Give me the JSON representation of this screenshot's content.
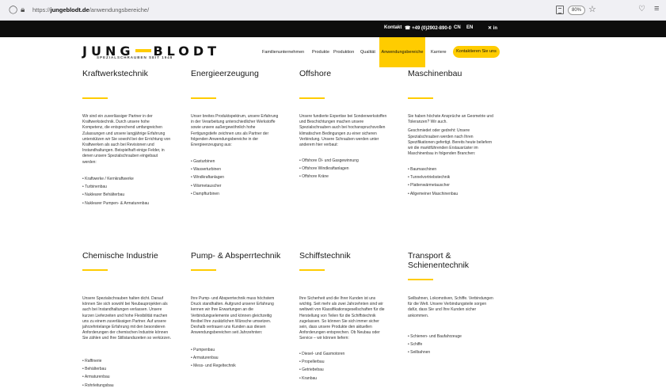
{
  "browser": {
    "url_prefix": "https://",
    "url_domain": "jungeblodt.de",
    "url_path": "/anwendungsbereiche/",
    "zoom": "80%"
  },
  "topbar": {
    "kontakt": "Kontakt",
    "phone": "☎ +49 (0)2902-890-0",
    "lang_cn": "CN",
    "lang_en": "EN",
    "social": "✕ in"
  },
  "header": {
    "logo_left": "JUNG",
    "logo_right": "BLODT",
    "logo_sub": "SPEZIALSCHRAUBEN SEIT 1948",
    "nav": [
      "Familienunternehmen",
      "Produkte",
      "Produktion",
      "Qualität",
      "Anwendungsbereiche",
      "Karriere"
    ],
    "cta": "Kontaktieren Sie uns"
  },
  "cards": [
    {
      "title": "Kraftwerkstechnik",
      "paragraphs": [
        "Wir sind ein zuverlässiger Partner in der Kraftwerkstechnik. Durch unsere hohe Kompetenz, die entsprechend umfangreichen Zulassungen und unsere langjährige Erfahrung unterstützen wir Sie sowohl bei der Errichtung von Kraftwerken als auch bei Revisionen und Instandhaltungen. Beispielhaft einige Felder, in denen unsere Spezialschrauben eingebaut werden:"
      ],
      "items": [
        "Kraftwerke / Kernkraftwerke",
        "Turbinenbau",
        "Nuklearer Behälterbau",
        "Nuklearer Pumpen- & Armaturenbau"
      ]
    },
    {
      "title": "Energieerzeugung",
      "paragraphs": [
        "Unser breites Produktspektrum, unsere Erfahrung in der Verarbeitung unterschiedlicher Werkstoffe sowie unsere außergewöhnlich hohe Fertigungstiefe zeichnen uns als Partner der folgenden Anwendungsbereiche in der Energieerzeugung aus:"
      ],
      "items": [
        "Gasturbinen",
        "Wasserturbinen",
        "Windkraftanlagen",
        "Wärmetauscher",
        "Dampfturbinen"
      ]
    },
    {
      "title": "Offshore",
      "paragraphs": [
        "Unsere fundierte Expertise bei Sonderwerkstoffen und Beschichtungen machen unsere Spezialschrauben auch bei hochanspruchsvollen klimatischen Bedingungen zu einer sicheren Verbindung. Unsere Schrauben werden unter anderem hier verbaut:"
      ],
      "items": [
        "Offshore Öl- und Gasgewinnung",
        "Offshore Windkraftanlagen",
        "Offshore Kräne"
      ]
    },
    {
      "title": "Maschinenbau",
      "paragraphs": [
        "Sie haben höchste Ansprüche an Geometrie und Toleranzen? Wir auch.",
        "Geschmiedet oder gedreht: Unsere Spezialschrauben werden nach Ihren Spezifikationen gefertigt. Bereits heute beliefern wir die marktführenden Erstausrüster im Maschinenbau in folgenden Branchen:"
      ],
      "items": [
        "Baumaschinen",
        "Tunnelvortriebstechnik",
        "Plattenwärmetauscher",
        "Allgemeiner Maschinenbau"
      ]
    },
    {
      "title": "Chemische Industrie",
      "paragraphs": [
        "Unsere Spezialschrauben halten dicht. Darauf können Sie sich sowohl bei Neubauprojekten als auch bei Instandhaltungen verlassen. Unsere kurzen Lieferzeiten und hohe Flexibilität machen uns zu einem zuverlässigen Partner. Auf unsere jahrzehntelange Erfahrung mit den besonderen Anforderungen der chemischen Industrie können Sie zählen und Ihre Stillstandszeiten so verkürzen."
      ],
      "items": [
        "Raffinerie",
        "Behälterbau",
        "Armaturenbau",
        "Rohrleitungsbau"
      ]
    },
    {
      "title": "Pump- & Absperrtechnik",
      "paragraphs": [
        "Ihre Pump- und Absperrtechnik muss höchstem Druck standhalten. Aufgrund unserer Erfahrung kennen wir Ihre Erwartungen an die Verbindungselemente und können gleichzeitig flexibel Ihre zusätzlichen Wünsche umsetzen. Deshalb vertrauen uns Kunden aus diesen Anwendungsbereichen seit Jahrzehnten:"
      ],
      "items": [
        "Pumpenbau",
        "Armaturenbau",
        "Mess- und Regeltechnik"
      ]
    },
    {
      "title": "Schiffstechnik",
      "paragraphs": [
        "Ihre Sicherheit und die Ihrer Kunden ist uns wichtig. Seit mehr als zwei Jahrzehnten sind wir weltweit von Klassifikationsgesellschaften für die Herstellung von Teilen für die Schiffstechnik zugelassen. So können Sie sich immer sicher sein, dass unsere Produkte den aktuellen Anforderungen entsprechen. Ob Neubau oder Service – wir können liefern:"
      ],
      "items": [
        "Diesel- und Gasmotoren",
        "Propellerbau",
        "Getriebebau",
        "Kranbau"
      ]
    },
    {
      "title": "Transport & Schienentechnik",
      "paragraphs": [
        "Seilbahnen, Lokomotiven, Schiffe. Verbindungen für die Welt. Unsere Verbindungsteile sorgen dafür, dass Sie und Ihre Kunden sicher ankommen."
      ],
      "items": [
        "Schienen- und Baufahrzeuge",
        "Schiffe",
        "Seilbahnen"
      ]
    }
  ]
}
